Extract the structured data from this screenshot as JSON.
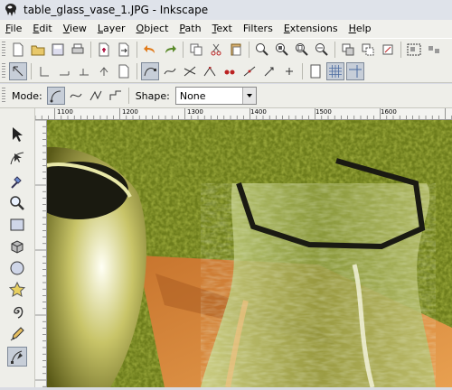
{
  "window": {
    "title": "table_glass_vase_1.JPG - Inkscape"
  },
  "menu": [
    {
      "key": "F",
      "rest": "ile",
      "name": "menu-file"
    },
    {
      "key": "E",
      "rest": "dit",
      "name": "menu-edit"
    },
    {
      "key": "V",
      "rest": "iew",
      "name": "menu-view"
    },
    {
      "key": "L",
      "rest": "ayer",
      "name": "menu-layer"
    },
    {
      "key": "O",
      "rest": "bject",
      "name": "menu-object"
    },
    {
      "key": "P",
      "rest": "ath",
      "name": "menu-path"
    },
    {
      "key": "T",
      "rest": "ext",
      "name": "menu-text"
    },
    {
      "key": "",
      "rest": "Filters",
      "name": "menu-filters"
    },
    {
      "key": "E",
      "rest": "xtensions",
      "name": "menu-extensions"
    },
    {
      "key": "H",
      "rest": "elp",
      "name": "menu-help"
    }
  ],
  "tool_controls": {
    "mode_label": "Mode:",
    "shape_label": "Shape:",
    "shape_value": "None"
  },
  "ruler": {
    "labels": [
      "1100",
      "1200",
      "1300",
      "1400",
      "1500",
      "1600"
    ]
  },
  "colors": {
    "grass": "#6b7a1a",
    "table": "#d98a3e",
    "path_stroke": "#1a1a12"
  }
}
